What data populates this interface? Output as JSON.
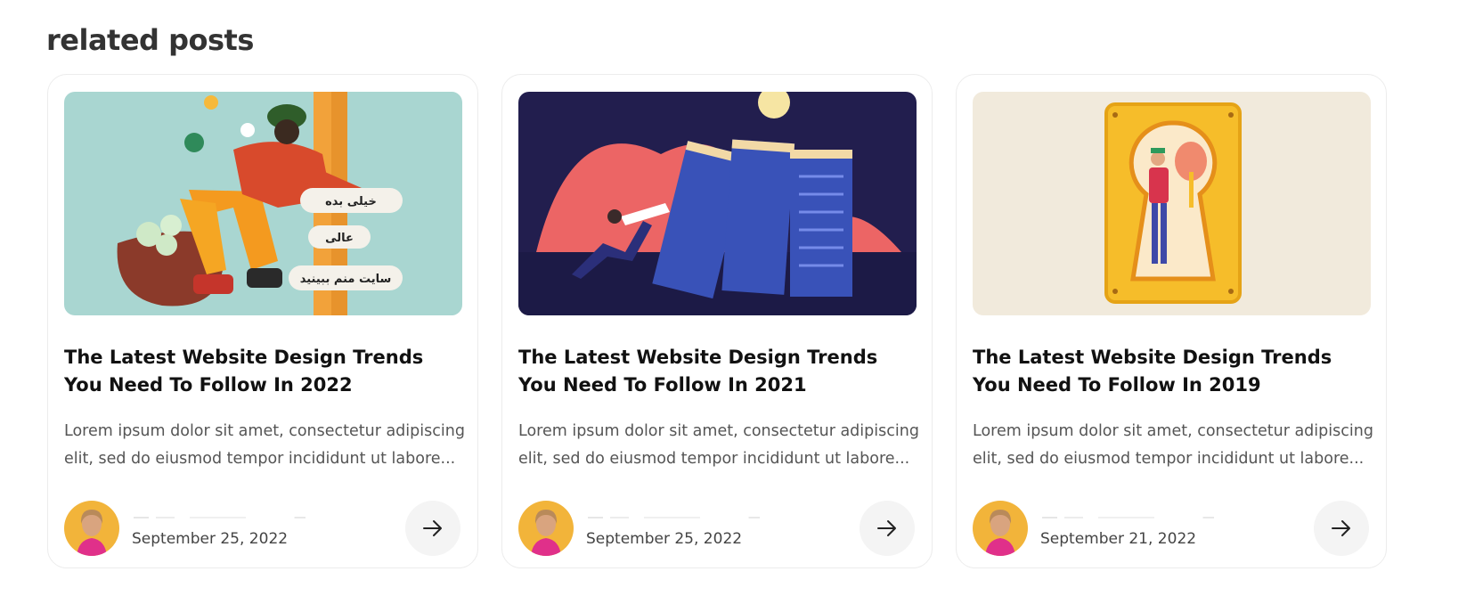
{
  "section": {
    "title": "related posts"
  },
  "posts": [
    {
      "title": "The Latest Website Design Trends You Need To Follow In 2022",
      "excerpt": "Lorem ipsum dolor sit amet, consectetur adipiscing elit, sed do eiusmod tempor incididunt ut labore...",
      "date": "September 25, 2022",
      "image_labels": [
        "خیلی بده",
        "عالی",
        "سایت منم ببینید"
      ],
      "image_icon": "social-reactions-illustration",
      "arrow_icon": "arrow-right-icon"
    },
    {
      "title": "The Latest Website Design Trends You Need To Follow In 2021",
      "excerpt": "Lorem ipsum dolor sit amet, consectetur adipiscing elit, sed do eiusmod tempor incididunt ut labore...",
      "date": "September 25, 2022",
      "image_icon": "server-racks-illustration",
      "arrow_icon": "arrow-right-icon"
    },
    {
      "title": "The Latest Website Design Trends You Need To Follow In 2019",
      "excerpt": "Lorem ipsum dolor sit amet, consectetur adipiscing elit, sed do eiusmod tempor incididunt ut labore...",
      "date": "September 21, 2022",
      "image_icon": "keyhole-illustration",
      "arrow_icon": "arrow-right-icon"
    }
  ],
  "colors": {
    "card_border": "#ececec",
    "arrow_button_bg": "#f4f4f4",
    "title_text": "#111111",
    "body_text": "#555555"
  }
}
